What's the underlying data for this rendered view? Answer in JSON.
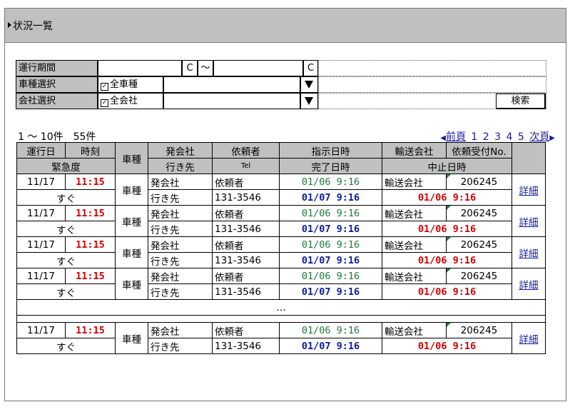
{
  "page": {
    "title": "状況一覧"
  },
  "search": {
    "period_label": "運行期間",
    "period_from_value": "",
    "period_cal_from": "C",
    "period_tilde": "～",
    "period_to_value": "",
    "period_cal_to": "C",
    "vehicle_label": "車種選択",
    "vehicle_all_label": "全車種",
    "vehicle_all_checked": true,
    "vehicle_select_value": "",
    "company_label": "会社選択",
    "company_all_label": "全会社",
    "company_all_checked": true,
    "company_select_value": "",
    "search_button": "検索"
  },
  "results": {
    "count_text": "1 ～ 10件　55件",
    "pager": {
      "prev": "前頁",
      "pages": [
        "1",
        "2",
        "3",
        "4",
        "5"
      ],
      "next": "次頁"
    }
  },
  "table": {
    "headers": {
      "date": "運行日",
      "time": "時刻",
      "vehicle": "車種",
      "from": "発会社",
      "client": "依頼者",
      "instruct": "指示日時",
      "carrier": "輸送会社",
      "receipt_no": "依頼受付No.",
      "urgency": "緊急度",
      "to": "行き先",
      "tel": "Tel",
      "complete": "完了日時",
      "cancel": "中止日時"
    },
    "rows": [
      {
        "date": "11/17",
        "time": "11:15",
        "vehicle": "車種",
        "from": "発会社",
        "client": "依頼者",
        "instruct": "01/06 9:16",
        "carrier": "輸送会社",
        "receipt_no": "206245",
        "urgency": "すぐ",
        "to": "行き先",
        "tel": "131-3546",
        "complete": "01/07 9:16",
        "cancel": "01/06 9:16",
        "detail": "詳細"
      },
      {
        "date": "11/17",
        "time": "11:15",
        "vehicle": "車種",
        "from": "発会社",
        "client": "依頼者",
        "instruct": "01/06 9:16",
        "carrier": "輸送会社",
        "receipt_no": "206245",
        "urgency": "すぐ",
        "to": "行き先",
        "tel": "131-3546",
        "complete": "01/07 9:16",
        "cancel": "01/06 9:16",
        "detail": "詳細"
      },
      {
        "date": "11/17",
        "time": "11:15",
        "vehicle": "車種",
        "from": "発会社",
        "client": "依頼者",
        "instruct": "01/06 9:16",
        "carrier": "輸送会社",
        "receipt_no": "206245",
        "urgency": "すぐ",
        "to": "行き先",
        "tel": "131-3546",
        "complete": "01/07 9:16",
        "cancel": "01/06 9:16",
        "detail": "詳細"
      },
      {
        "date": "11/17",
        "time": "11:15",
        "vehicle": "車種",
        "from": "発会社",
        "client": "依頼者",
        "instruct": "01/06 9:16",
        "carrier": "輸送会社",
        "receipt_no": "206245",
        "urgency": "すぐ",
        "to": "行き先",
        "tel": "131-3546",
        "complete": "01/07 9:16",
        "cancel": "01/06 9:16",
        "detail": "詳細"
      }
    ],
    "ellipsis": "…",
    "last_row": {
      "date": "11/17",
      "time": "11:15",
      "vehicle": "車種",
      "from": "発会社",
      "client": "依頼者",
      "instruct": "01/06 9:16",
      "carrier": "輸送会社",
      "receipt_no": "206245",
      "urgency": "すぐ",
      "to": "行き先",
      "tel": "131-3546",
      "complete": "01/07 9:16",
      "cancel": "01/06 9:16",
      "detail": "詳細"
    }
  },
  "colors": {
    "header_bg": "#c0c0c0",
    "time_red": "#d10000",
    "instruct_green": "#1f7a3a",
    "complete_blue": "#0a1aa0",
    "link_blue": "#1a1aa6"
  }
}
